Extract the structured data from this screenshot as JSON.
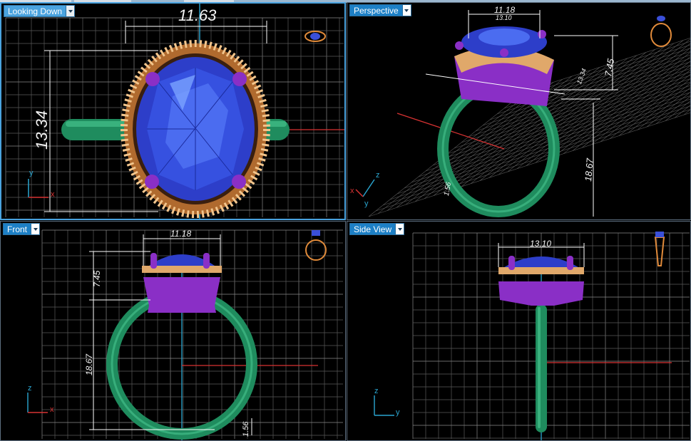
{
  "colors": {
    "grid": "#5a5a5a",
    "grid_major": "#8a8a8a",
    "gem": "#2d3ec9",
    "prongs": "#8a2fc6",
    "band": "#1f8c5e",
    "beads": "#e0a86a",
    "dim_line": "#ffffff",
    "axis_x": "#d83232",
    "axis_y": "#2aa6d0",
    "label_bg": "#4aa3df"
  },
  "icons": {
    "dropdown": "chevron-down-icon",
    "nav_cube": "ring-preview-icon"
  },
  "viewports": {
    "top": {
      "label": "Looking Down",
      "dims": {
        "width": "11.63",
        "height": "13.34"
      },
      "axes": {
        "a": "y",
        "b": "x"
      }
    },
    "perspective": {
      "label": "Perspective",
      "dims": {
        "width": "11.18",
        "width_inner": "13.10",
        "depth": "7.45",
        "side": "13.34",
        "band": "18.67",
        "shank": "1.56"
      },
      "axes": {
        "a": "z",
        "b": "y",
        "c": "x"
      }
    },
    "front": {
      "label": "Front",
      "dims": {
        "width": "11.18",
        "head": "7.45",
        "ring": "18.67",
        "shank": "1.56"
      },
      "axes": {
        "a": "z",
        "b": "x"
      }
    },
    "side": {
      "label": "Side View",
      "dims": {
        "width": "13.10"
      },
      "axes": {
        "a": "z",
        "b": "y"
      }
    }
  }
}
